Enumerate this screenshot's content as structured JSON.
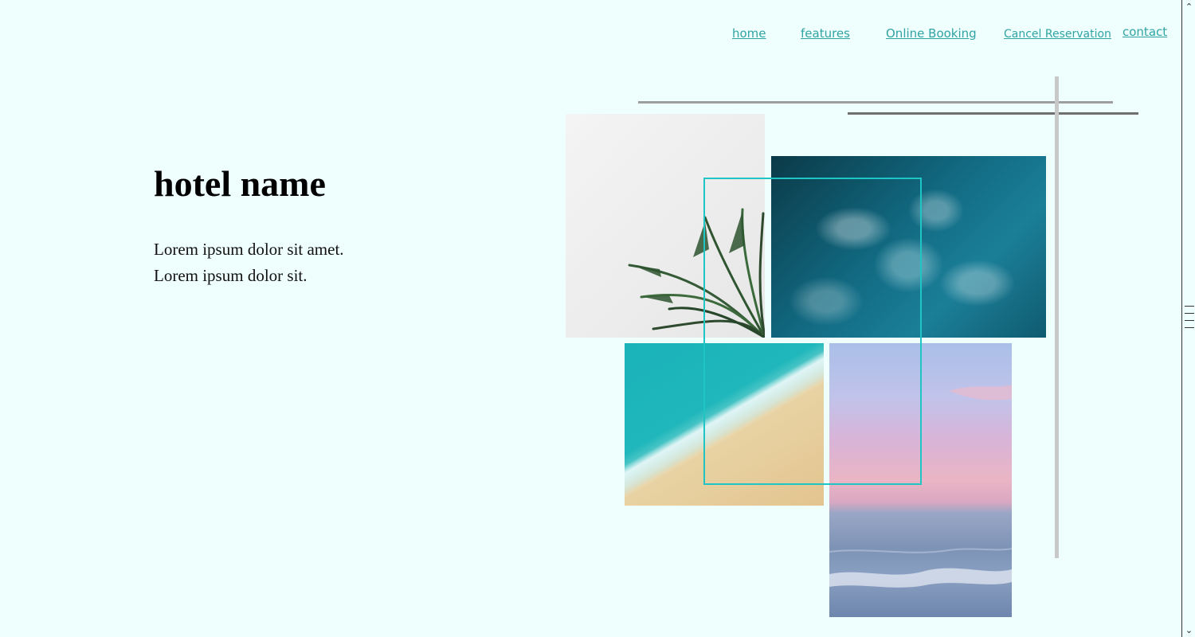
{
  "nav": {
    "items": [
      {
        "label": "home"
      },
      {
        "label": "features"
      },
      {
        "label": "Online Booking"
      },
      {
        "label": "Cancel Reservation"
      },
      {
        "label": "contact"
      }
    ]
  },
  "hero": {
    "title": "hotel name",
    "line1": "Lorem ipsum dolor sit amet.",
    "line2": "Lorem ipsum dolor sit."
  },
  "colors": {
    "background": "#eefffe",
    "link": "#31a3a3",
    "frame_accent": "#1fc4c4"
  },
  "icons": {
    "scroll_up": "chevron-up-icon",
    "scroll_down": "chevron-down-icon"
  }
}
